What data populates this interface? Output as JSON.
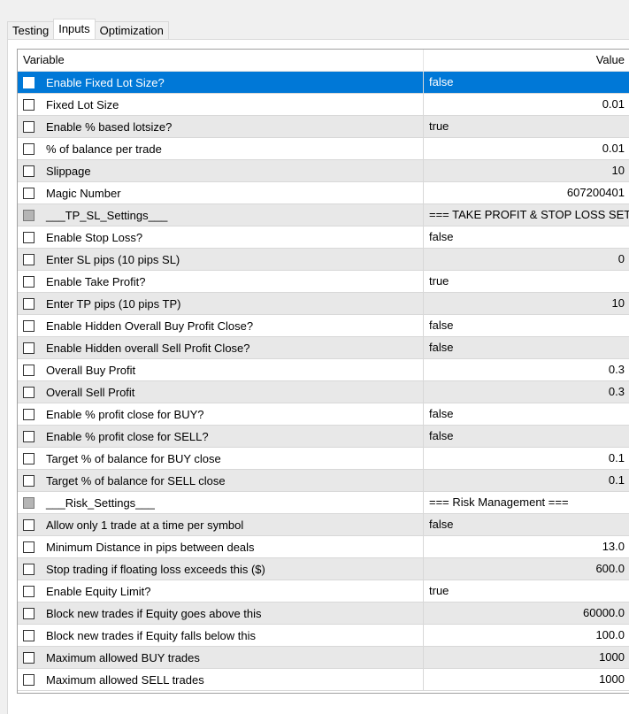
{
  "tabs": [
    {
      "label": "Testing",
      "active": false
    },
    {
      "label": "Inputs",
      "active": true
    },
    {
      "label": "Optimization",
      "active": false
    }
  ],
  "grid": {
    "columns": {
      "variable": "Variable",
      "value": "Value"
    },
    "rows": [
      {
        "variable": "Enable Fixed Lot Size?",
        "value": "false",
        "numeric": false,
        "checked": false,
        "disabled": false,
        "selected": true
      },
      {
        "variable": "Fixed Lot Size",
        "value": "0.01",
        "numeric": true,
        "checked": false,
        "disabled": false
      },
      {
        "variable": "Enable % based lotsize?",
        "value": "true",
        "numeric": false,
        "checked": false,
        "disabled": false
      },
      {
        "variable": "% of balance per trade",
        "value": "0.01",
        "numeric": true,
        "checked": false,
        "disabled": false
      },
      {
        "variable": "Slippage",
        "value": "10",
        "numeric": true,
        "checked": false,
        "disabled": false
      },
      {
        "variable": "Magic Number",
        "value": "607200401",
        "numeric": true,
        "checked": false,
        "disabled": false
      },
      {
        "variable": "___TP_SL_Settings___",
        "value": "=== TAKE PROFIT & STOP LOSS SETTINGS ===",
        "numeric": false,
        "checked": false,
        "disabled": true
      },
      {
        "variable": "Enable Stop Loss?",
        "value": "false",
        "numeric": false,
        "checked": false,
        "disabled": false
      },
      {
        "variable": "Enter SL pips (10 pips SL)",
        "value": "0",
        "numeric": true,
        "checked": false,
        "disabled": false
      },
      {
        "variable": "Enable Take Profit?",
        "value": "true",
        "numeric": false,
        "checked": false,
        "disabled": false
      },
      {
        "variable": "Enter TP pips (10 pips TP)",
        "value": "10",
        "numeric": true,
        "checked": false,
        "disabled": false
      },
      {
        "variable": "Enable Hidden Overall Buy Profit Close?",
        "value": "false",
        "numeric": false,
        "checked": false,
        "disabled": false
      },
      {
        "variable": "Enable Hidden overall Sell Profit Close?",
        "value": "false",
        "numeric": false,
        "checked": false,
        "disabled": false
      },
      {
        "variable": "Overall Buy Profit",
        "value": "0.3",
        "numeric": true,
        "checked": false,
        "disabled": false
      },
      {
        "variable": "Overall Sell Profit",
        "value": "0.3",
        "numeric": true,
        "checked": false,
        "disabled": false
      },
      {
        "variable": "Enable % profit close for BUY?",
        "value": "false",
        "numeric": false,
        "checked": false,
        "disabled": false
      },
      {
        "variable": "Enable % profit close for SELL?",
        "value": "false",
        "numeric": false,
        "checked": false,
        "disabled": false
      },
      {
        "variable": "Target % of balance for BUY close",
        "value": "0.1",
        "numeric": true,
        "checked": false,
        "disabled": false
      },
      {
        "variable": "Target % of balance for SELL close",
        "value": "0.1",
        "numeric": true,
        "checked": false,
        "disabled": false
      },
      {
        "variable": "___Risk_Settings___",
        "value": "=== Risk Management ===",
        "numeric": false,
        "checked": false,
        "disabled": true
      },
      {
        "variable": "Allow only 1 trade at a time per symbol",
        "value": "false",
        "numeric": false,
        "checked": false,
        "disabled": false
      },
      {
        "variable": "Minimum Distance in pips between deals",
        "value": "13.0",
        "numeric": true,
        "checked": false,
        "disabled": false
      },
      {
        "variable": "Stop trading if floating loss exceeds this ($)",
        "value": "600.0",
        "numeric": true,
        "checked": false,
        "disabled": false
      },
      {
        "variable": "Enable Equity Limit?",
        "value": "true",
        "numeric": false,
        "checked": false,
        "disabled": false
      },
      {
        "variable": "Block new trades if Equity goes above this",
        "value": "60000.0",
        "numeric": true,
        "checked": false,
        "disabled": false
      },
      {
        "variable": "Block new trades if Equity falls below this",
        "value": "100.0",
        "numeric": true,
        "checked": false,
        "disabled": false
      },
      {
        "variable": "Maximum allowed BUY trades",
        "value": "1000",
        "numeric": true,
        "checked": false,
        "disabled": false
      },
      {
        "variable": "Maximum allowed SELL trades",
        "value": "1000",
        "numeric": true,
        "checked": false,
        "disabled": false
      }
    ]
  }
}
